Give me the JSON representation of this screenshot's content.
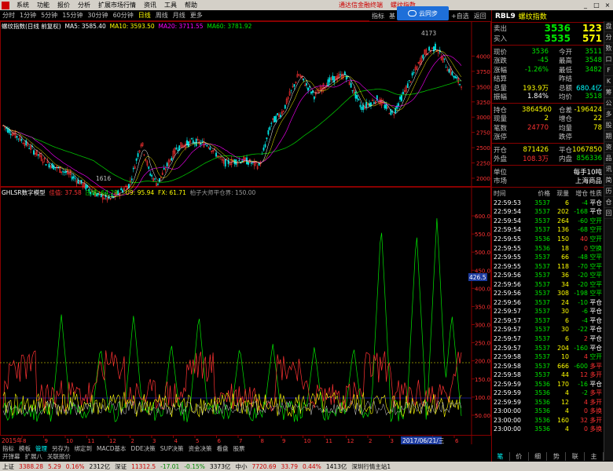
{
  "menu": {
    "items": [
      "系统",
      "功能",
      "报价",
      "分析",
      "扩展市场行情",
      "资讯",
      "工具",
      "帮助"
    ],
    "promo": "通达信金融终端",
    "promo2": "螺纹指数",
    "cloud_label": "云同步"
  },
  "toolbar": {
    "periods": [
      "分时",
      "1分钟",
      "5分钟",
      "15分钟",
      "30分钟",
      "60分钟",
      "日线",
      "周线",
      "月线",
      "更多"
    ],
    "active": "日线",
    "right_tools": [
      "指标",
      "基",
      "",
      "",
      "+自选",
      "返回"
    ]
  },
  "chart_header": {
    "text": "螺纹指数(日线 前复权)",
    "ma5": "MA5: 3585.40",
    "ma10": "MA10: 3593.50",
    "ma20": "MA20: 3711.55",
    "ma60": "MA60: 3781.92"
  },
  "indicator_header": {
    "name": "GHLSR数字模型",
    "a_label": "佳值:",
    "a_value": "37.58",
    "b_label": "庄顺:",
    "b_value": "64.29",
    "c_label": "",
    "c_value": "",
    "u_label": "U9:",
    "u_value": "95.94",
    "fx_label": "FX:",
    "fx_value": "61.71",
    "title_tail": "柏子大师平仓界: 150.00"
  },
  "price_axis": [
    "4000",
    "3750",
    "3500",
    "3250",
    "3000",
    "2750",
    "2500",
    "2250",
    "2000"
  ],
  "ind_axis": [
    "600.0",
    "550.0",
    "500.0",
    "450.0",
    "400.0",
    "350.0",
    "300.0",
    "250.0",
    "200.0",
    "150.0",
    "100.0",
    "50.00"
  ],
  "ind_marker": "426.5",
  "peak_label": "4173",
  "low_label": "1616",
  "year_label": "2015年",
  "date_label": "2017/06/21/三",
  "months": [
    "8",
    "9",
    "10",
    "11",
    "12",
    "2",
    "3",
    "4",
    "5",
    "6",
    "7",
    "8",
    "9",
    "10",
    "11",
    "12",
    "2",
    "3",
    "4",
    "5",
    "6"
  ],
  "quote": {
    "code": "RBL9",
    "name": "螺纹指数",
    "sell": {
      "label": "卖出",
      "price": "3536",
      "vol": "123"
    },
    "buy": {
      "label": "买入",
      "price": "3535",
      "vol": "571"
    },
    "rows": [
      {
        "k": "现价",
        "v": "3536",
        "k2": "今开",
        "v2": "3511",
        "vc": "green",
        "v2c": "green"
      },
      {
        "k": "涨跌",
        "v": "-45",
        "k2": "最高",
        "v2": "3548",
        "vc": "green",
        "v2c": "green"
      },
      {
        "k": "涨幅",
        "v": "-1.26%",
        "k2": "最低",
        "v2": "3482",
        "vc": "green",
        "v2c": "green"
      },
      {
        "k": "结算",
        "v": "",
        "k2": "昨结",
        "v2": "",
        "vc": "white",
        "v2c": "white"
      },
      {
        "k": "总量",
        "v": "193.9万",
        "k2": "总额",
        "v2": "680.4亿",
        "vc": "yellow",
        "v2c": "cyan"
      },
      {
        "k": "振幅",
        "v": "1.84%",
        "k2": "均价",
        "v2": "3518",
        "vc": "white",
        "v2c": "green"
      }
    ],
    "rows2": [
      {
        "k": "持仓",
        "v": "3864560",
        "k2": "仓差",
        "v2": "-196424",
        "vc": "yellow",
        "v2c": "yellow"
      },
      {
        "k": "现量",
        "v": "2",
        "k2": "增仓",
        "v2": "22",
        "vc": "yellow",
        "v2c": "yellow"
      },
      {
        "k": "笔数",
        "v": "24770",
        "k2": "均量",
        "v2": "78",
        "vc": "red",
        "v2c": "yellow"
      },
      {
        "k": "涨停",
        "v": "",
        "k2": "跌停",
        "v2": "",
        "vc": "white",
        "v2c": "white"
      }
    ],
    "rows3": [
      {
        "k": "开仓",
        "v": "871426",
        "k2": "平仓",
        "v2": "1067850",
        "vc": "yellow",
        "v2c": "yellow"
      },
      {
        "k": "外盘",
        "v": "108.3万",
        "k2": "内盘",
        "v2": "856336",
        "vc": "red",
        "v2c": "green"
      }
    ],
    "unit": {
      "k": "单位",
      "v": "每手10吨"
    },
    "market": {
      "k": "市场",
      "v": "上海商品"
    }
  },
  "trades_header": [
    "时间",
    "价格",
    "现量",
    "增仓",
    "性质"
  ],
  "trades": [
    [
      "22:59:53",
      "3537",
      "6",
      "-4",
      "平仓"
    ],
    [
      "22:59:54",
      "3537",
      "202",
      "-168",
      "平仓"
    ],
    [
      "22:59:54",
      "3537",
      "264",
      "-60",
      "空开"
    ],
    [
      "22:59:54",
      "3537",
      "136",
      "-68",
      "空开"
    ],
    [
      "22:59:55",
      "3536",
      "150",
      "40",
      "空开"
    ],
    [
      "22:59:55",
      "3536",
      "18",
      "0",
      "空换"
    ],
    [
      "22:59:55",
      "3537",
      "66",
      "-48",
      "空平"
    ],
    [
      "22:59:55",
      "3537",
      "118",
      "-70",
      "空平"
    ],
    [
      "22:59:56",
      "3537",
      "36",
      "-20",
      "空平"
    ],
    [
      "22:59:56",
      "3537",
      "34",
      "-20",
      "空平"
    ],
    [
      "22:59:56",
      "3537",
      "308",
      "-198",
      "空平"
    ],
    [
      "22:59:56",
      "3537",
      "24",
      "-10",
      "平仓"
    ],
    [
      "22:59:57",
      "3537",
      "30",
      "-6",
      "平仓"
    ],
    [
      "22:59:57",
      "3537",
      "6",
      "-4",
      "平仓"
    ],
    [
      "22:59:57",
      "3537",
      "30",
      "-22",
      "平仓"
    ],
    [
      "22:59:57",
      "3537",
      "6",
      "2",
      "平仓"
    ],
    [
      "22:59:57",
      "3537",
      "204",
      "-160",
      "平仓"
    ],
    [
      "22:59:58",
      "3537",
      "10",
      "4",
      "空开"
    ],
    [
      "22:59:58",
      "3537",
      "666",
      "-600",
      "多平"
    ],
    [
      "22:59:58",
      "3537",
      "44",
      "12",
      "多开"
    ],
    [
      "22:59:59",
      "3536",
      "170",
      "-16",
      "平仓"
    ],
    [
      "22:59:59",
      "3536",
      "4",
      "-2",
      "多平"
    ],
    [
      "22:59:59",
      "3536",
      "12",
      "4",
      "多开"
    ],
    [
      "23:00:00",
      "3536",
      "4",
      "0",
      "多换"
    ],
    [
      "23:00:00",
      "3536",
      "160",
      "32",
      "多开"
    ],
    [
      "23:00:00",
      "3536",
      "4",
      "0",
      "多换"
    ]
  ],
  "right_tabs": [
    "笔",
    "价",
    "细",
    "势",
    "联",
    "主"
  ],
  "side_buttons": [
    "盘",
    "分",
    "数",
    "口",
    "F",
    "K",
    "筹",
    "公",
    "多",
    "股",
    "期",
    "资",
    "品",
    "讯",
    "简",
    "历",
    "仓",
    "回"
  ],
  "bottom_tabs": [
    "指标",
    "模板",
    "管理",
    "另存为",
    "绑定到",
    "MACD基本",
    "DDE决策",
    "SUP决策",
    "资金决策",
    "看盘",
    "股票"
  ],
  "bottom_active": "管理",
  "bottom_tabs2": [
    "开弹幕",
    "扩展八",
    "关联报价"
  ],
  "status": [
    {
      "text": "上证",
      "c": "black"
    },
    {
      "text": "3388.28",
      "c": "red"
    },
    {
      "text": "5.29",
      "c": "red"
    },
    {
      "text": "0.16%",
      "c": "red"
    },
    {
      "text": "2312亿",
      "c": "black"
    },
    {
      "text": "深证",
      "c": "black"
    },
    {
      "text": "11312.5",
      "c": "red"
    },
    {
      "text": "-17.01",
      "c": "green"
    },
    {
      "text": "-0.15%",
      "c": "green"
    },
    {
      "text": "3373亿",
      "c": "black"
    },
    {
      "text": "中小",
      "c": "black"
    },
    {
      "text": "7720.69",
      "c": "red"
    },
    {
      "text": "33.79",
      "c": "red"
    },
    {
      "text": "0.44%",
      "c": "red"
    },
    {
      "text": "1413亿",
      "c": "black"
    },
    {
      "text": "深圳行情主站1",
      "c": "black"
    }
  ],
  "colors": {
    "up": "#ff3232",
    "down": "#00e600",
    "ma5": "#ffffff",
    "ma10": "#ffff00",
    "ma20": "#ff00ff",
    "ma60": "#00c000",
    "bg": "#000000",
    "frame": "#800000"
  }
}
